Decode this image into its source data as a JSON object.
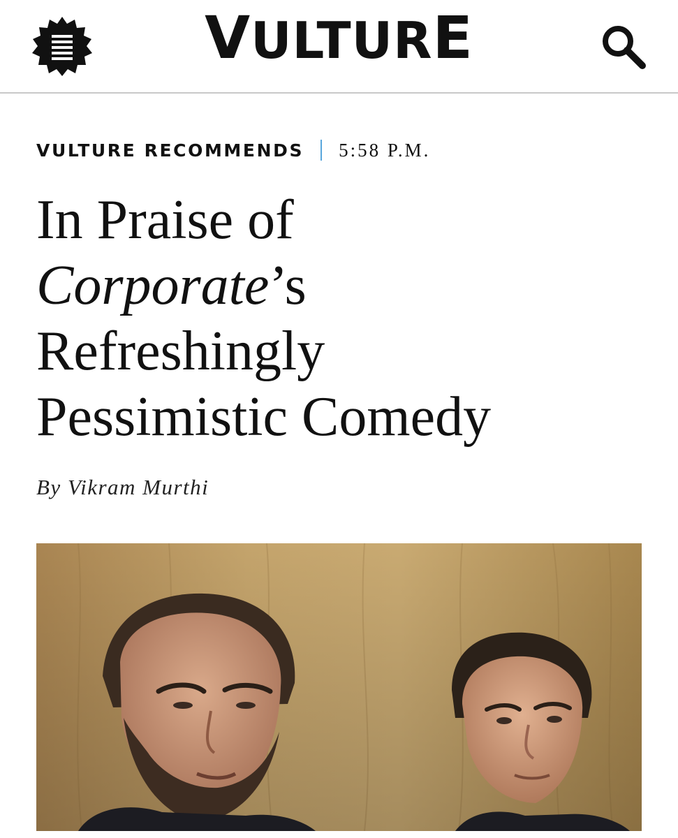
{
  "header": {
    "logo_prefix": "V",
    "logo_middle": "ULTUR",
    "logo_suffix": "E",
    "menu_icon": "menu-icon",
    "search_icon": "search-icon"
  },
  "article": {
    "rubric": "VULTURE RECOMMENDS",
    "timestamp": "5:58 P.M.",
    "headline": {
      "line1": "In Praise of",
      "italic_title": "Corporate",
      "possessive": "’s",
      "line3": "Refreshingly",
      "line4": "Pessimistic Comedy"
    },
    "byline_prefix": "By",
    "author": "Vikram Murthi"
  },
  "colors": {
    "accent_separator": "#58a6dc",
    "text": "#111111",
    "header_rule": "#c8c8c8"
  }
}
